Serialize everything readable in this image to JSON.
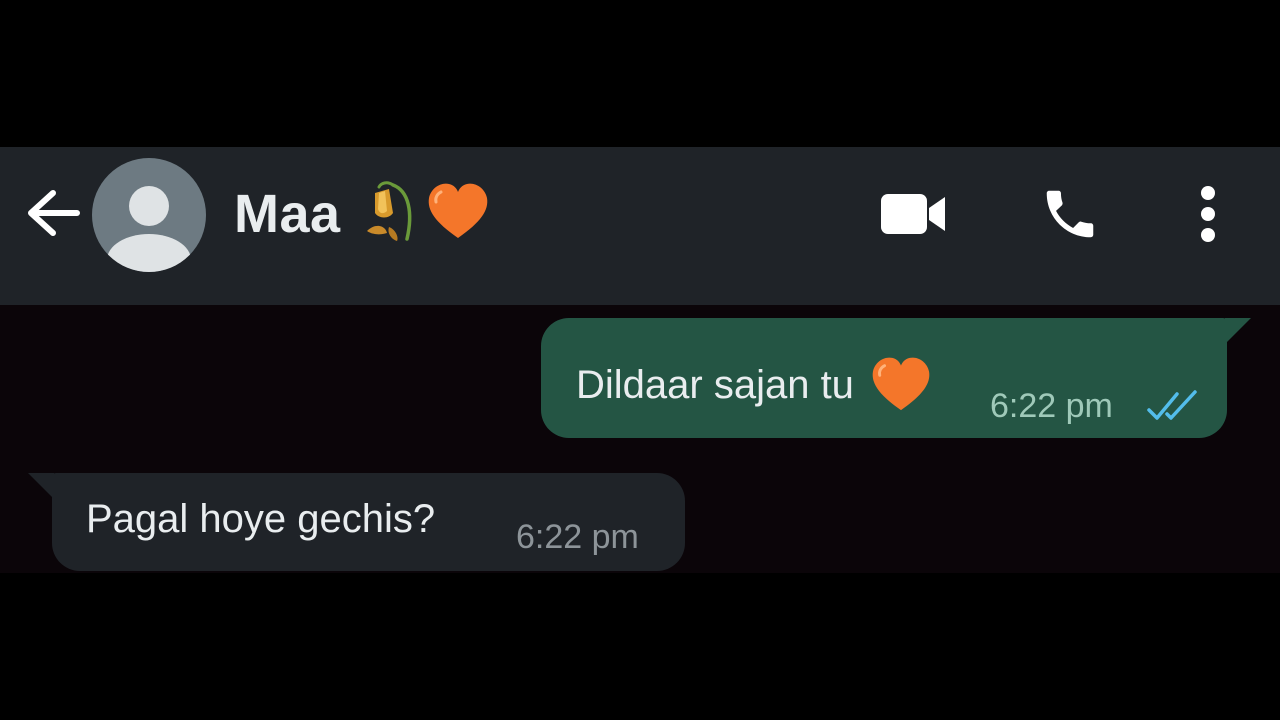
{
  "header": {
    "contact_name": "Maa",
    "name_emoji_icons": [
      "wilted-flower-icon",
      "orange-heart-icon"
    ],
    "back_icon": "arrow-left-icon",
    "video_icon": "videocam-icon",
    "call_icon": "phone-icon",
    "menu_icon": "more-vertical-icon"
  },
  "messages": [
    {
      "direction": "outgoing",
      "text": "Dildaar sajan tu",
      "emoji_icon": "orange-heart-icon",
      "time": "6:22 pm",
      "status_icon": "double-check-read-icon"
    },
    {
      "direction": "incoming",
      "text": "Pagal hoye gechis?",
      "time": "6:22 pm"
    }
  ],
  "colors": {
    "header_bg": "#1f2328",
    "chat_bg": "#0b0509",
    "outgoing_bubble": "#245544",
    "incoming_bubble": "#1f2328",
    "read_tick": "#53bdeb",
    "heart": "#f4762a",
    "text": "#e9edef"
  }
}
